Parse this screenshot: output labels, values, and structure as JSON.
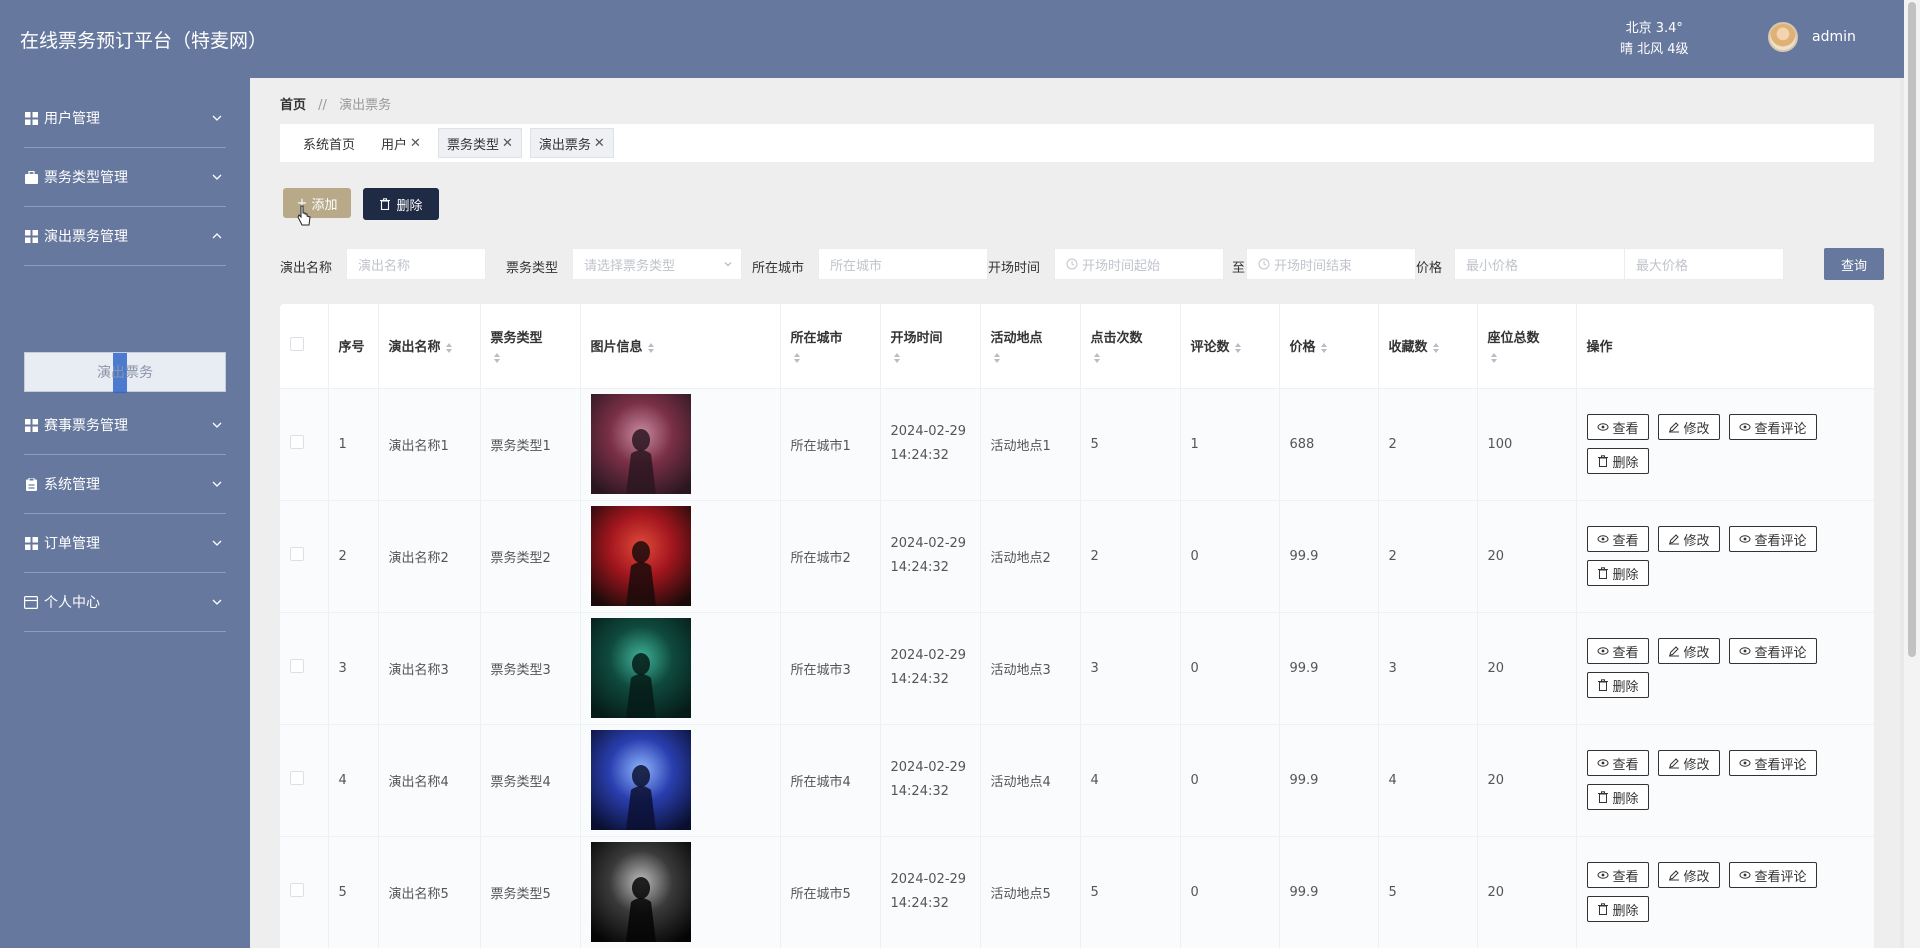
{
  "header": {
    "title": "在线票务预订平台（特麦网）",
    "weather_line1": "北京  3.4°",
    "weather_line2": "晴  北风  4级",
    "user_name": "admin"
  },
  "sidebar": {
    "items": [
      {
        "label": "用户管理",
        "icon": "grid-icon",
        "expanded": false
      },
      {
        "label": "票务类型管理",
        "icon": "briefcase-icon",
        "expanded": false
      },
      {
        "label": "演出票务管理",
        "icon": "grid-icon",
        "expanded": true
      },
      {
        "label": "赛事票务管理",
        "icon": "grid-icon",
        "expanded": false
      },
      {
        "label": "系统管理",
        "icon": "clipboard-icon",
        "expanded": false
      },
      {
        "label": "订单管理",
        "icon": "grid-icon",
        "expanded": false
      },
      {
        "label": "个人中心",
        "icon": "card-icon",
        "expanded": false
      }
    ],
    "submenu_active": "演出票务"
  },
  "breadcrumb": {
    "home": "首页",
    "separator": "//",
    "current": "演出票务"
  },
  "tabs": [
    {
      "label": "系统首页",
      "closable": false
    },
    {
      "label": "用户",
      "closable": true
    },
    {
      "label": "票务类型",
      "closable": true
    },
    {
      "label": "演出票务",
      "closable": true
    }
  ],
  "toolbar": {
    "add_label": "添加",
    "delete_label": "删除"
  },
  "filters": {
    "name_label": "演出名称",
    "name_placeholder": "演出名称",
    "type_label": "票务类型",
    "type_placeholder": "请选择票务类型",
    "city_label": "所在城市",
    "city_placeholder": "所在城市",
    "time_label": "开场时间",
    "time_start_placeholder": "开场时间起始",
    "time_to": "至",
    "time_end_placeholder": "开场时间结束",
    "price_label": "价格",
    "price_min_placeholder": "最小价格",
    "price_max_placeholder": "最大价格",
    "query_label": "查询"
  },
  "table": {
    "headers": {
      "index": "序号",
      "name": "演出名称",
      "type": "票务类型",
      "image": "图片信息",
      "city": "所在城市",
      "time": "开场时间",
      "venue": "活动地点",
      "clicks": "点击次数",
      "comments": "评论数",
      "price": "价格",
      "favorites": "收藏数",
      "seats": "座位总数",
      "actions": "操作"
    },
    "actions": {
      "view": "查看",
      "edit": "修改",
      "view_comments": "查看评论",
      "delete": "删除"
    },
    "rows": [
      {
        "index": "1",
        "name": "演出名称1",
        "type": "票务类型1",
        "city": "所在城市1",
        "date": "2024-02-29",
        "time": "14:24:32",
        "venue": "活动地点1",
        "clicks": "5",
        "comments": "1",
        "price": "688",
        "favorites": "2",
        "seats": "100",
        "poster_colors": [
          "#7a3046",
          "#2a1620",
          "#c98aa0"
        ]
      },
      {
        "index": "2",
        "name": "演出名称2",
        "type": "票务类型2",
        "city": "所在城市2",
        "date": "2024-02-29",
        "time": "14:24:32",
        "venue": "活动地点2",
        "clicks": "2",
        "comments": "0",
        "price": "99.9",
        "favorites": "2",
        "seats": "20",
        "poster_colors": [
          "#a3161e",
          "#1a0a0a",
          "#e04a3a"
        ]
      },
      {
        "index": "3",
        "name": "演出名称3",
        "type": "票务类型3",
        "city": "所在城市3",
        "date": "2024-02-29",
        "time": "14:24:32",
        "venue": "活动地点3",
        "clicks": "3",
        "comments": "0",
        "price": "99.9",
        "favorites": "3",
        "seats": "20",
        "poster_colors": [
          "#0f4a3e",
          "#061a16",
          "#3fb39a"
        ]
      },
      {
        "index": "4",
        "name": "演出名称4",
        "type": "票务类型4",
        "city": "所在城市4",
        "date": "2024-02-29",
        "time": "14:24:32",
        "venue": "活动地点4",
        "clicks": "4",
        "comments": "0",
        "price": "99.9",
        "favorites": "4",
        "seats": "20",
        "poster_colors": [
          "#2a3fb0",
          "#0a0f30",
          "#8fb6ff"
        ]
      },
      {
        "index": "5",
        "name": "演出名称5",
        "type": "票务类型5",
        "city": "所在城市5",
        "date": "2024-02-29",
        "time": "14:24:32",
        "venue": "活动地点5",
        "clicks": "5",
        "comments": "0",
        "price": "99.9",
        "favorites": "5",
        "seats": "20",
        "poster_colors": [
          "#3a3a3a",
          "#050505",
          "#bdbdbd"
        ]
      }
    ]
  },
  "colors": {
    "header_bg": "#66789e",
    "sidebar_bg": "#66789e",
    "add_btn": "#b8aa89",
    "delete_btn": "#1f2b44",
    "query_btn": "#66789e"
  }
}
